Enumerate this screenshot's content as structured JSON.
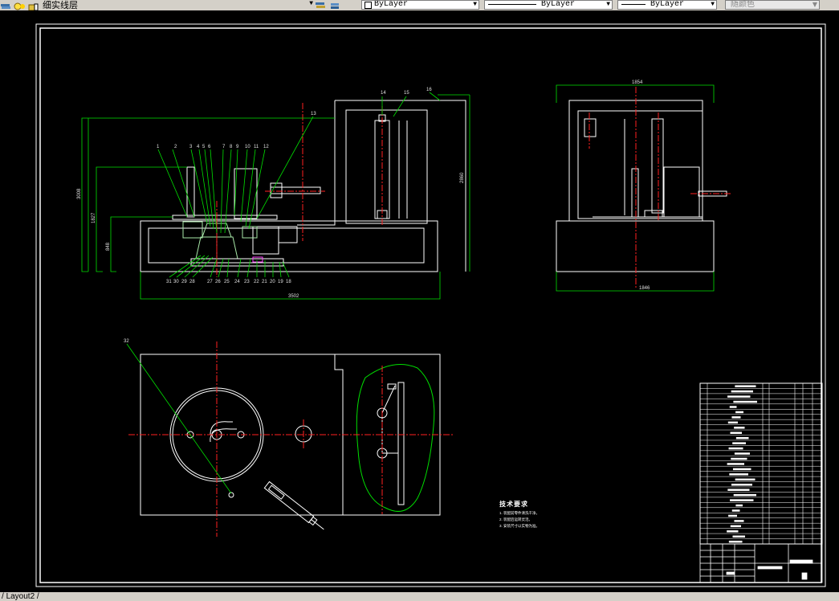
{
  "toolbar": {
    "layer_name": "细实线层",
    "color_combo": "ByLayer",
    "linetype_combo": "ByLayer",
    "lineweight_combo": "ByLayer",
    "plotstyle_combo": "随颜色"
  },
  "drawing": {
    "tech_title": "技术要求",
    "notes": [
      "1. 装配前零件清洗干净。",
      "2. 装配后运转灵活。",
      "3. 安装尺寸以实物为准。"
    ],
    "callouts_top": [
      "1",
      "2",
      "3",
      "4",
      "5",
      "6",
      "7",
      "8",
      "9",
      "10",
      "11",
      "12",
      "13",
      "14",
      "15",
      "16"
    ],
    "callouts_bottom": [
      "31",
      "30",
      "29",
      "28",
      "27",
      "26",
      "25",
      "24",
      "23",
      "22",
      "21",
      "20",
      "19",
      "18",
      "17"
    ],
    "callout_plan": "32",
    "dim_total_width": "3502",
    "dim_height_1": "3008",
    "dim_height_2": "1827",
    "dim_height_3": "848",
    "dim_height_right": "2860",
    "dim_side_top": "1854",
    "dim_side_bottom": "1846"
  },
  "status": {
    "layout_tab": "Layout2"
  }
}
